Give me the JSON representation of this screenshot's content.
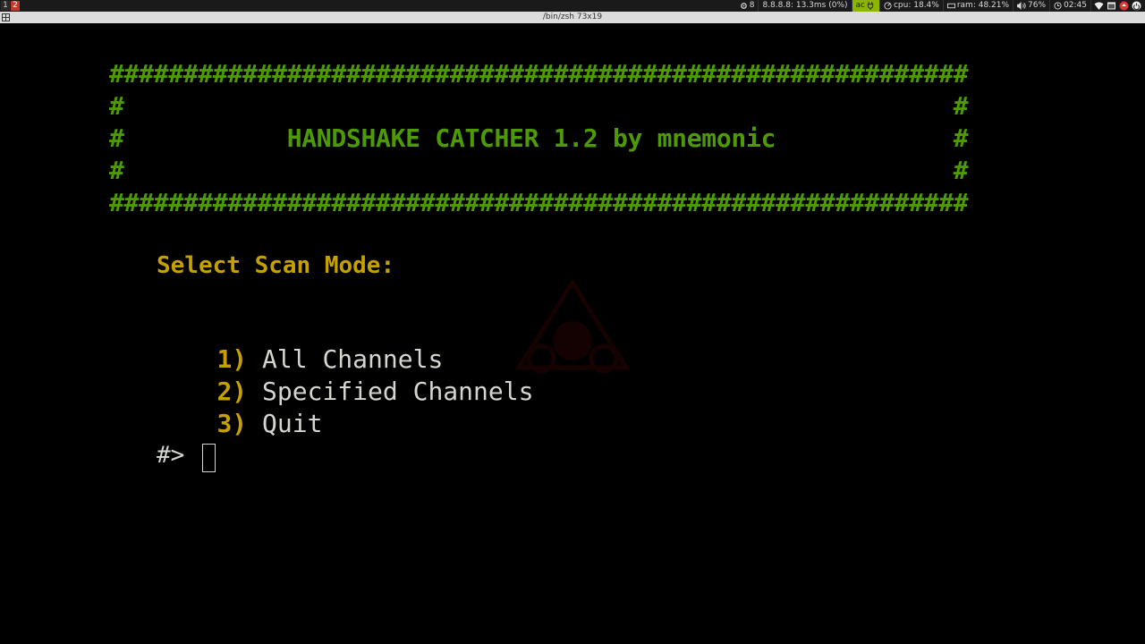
{
  "topbar": {
    "workspaces": [
      "1",
      "2"
    ],
    "active_workspace": "2",
    "status": {
      "updates": "8",
      "ping": "8.8.8.8: 13.3ms (0%)",
      "power": "ac",
      "cpu": "cpu: 18.4%",
      "ram": "ram: 48.21%",
      "volume": "76%",
      "clock": "02:45"
    },
    "colors": {
      "active_workspace": "#c0392b",
      "ac_badge": "#8cb400"
    }
  },
  "window": {
    "title": "/bin/zsh 73x19"
  },
  "terminal": {
    "banner": {
      "border_top": "##########################################################",
      "row_blank_1": "#                                                        #",
      "row_title": "#           HANDSHAKE CATCHER 1.2 by mnemonic            #",
      "row_blank_2": "#                                                        #",
      "border_bottom": "##########################################################"
    },
    "menu": {
      "header": "Select Scan Mode:",
      "options": [
        {
          "num": "1)",
          "label": "All Channels"
        },
        {
          "num": "2)",
          "label": "Specified Channels"
        },
        {
          "num": "3)",
          "label": "Quit"
        }
      ]
    },
    "prompt": "#>",
    "colors": {
      "banner": "#4e9a06",
      "highlight": "#c4a000",
      "text": "#d3d7cf",
      "background": "#000000"
    }
  }
}
